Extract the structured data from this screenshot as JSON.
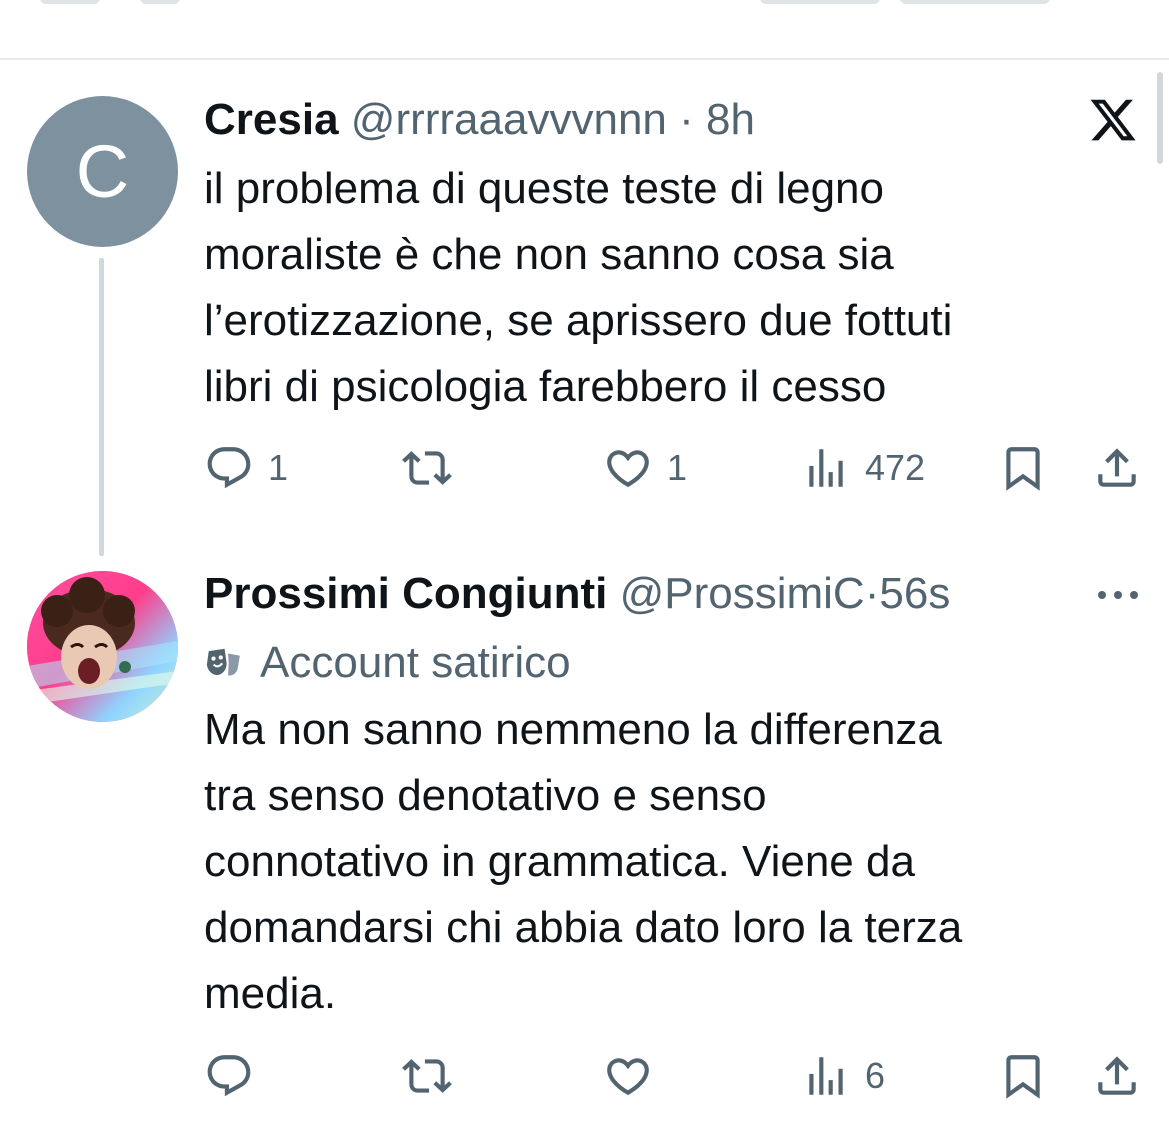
{
  "tweets": [
    {
      "avatar_letter": "C",
      "avatar_color": "#7d919e",
      "name": "Cresia",
      "handle": "@rrrraaavvvnnn",
      "separator": "·",
      "time": "8h",
      "text_lines": [
        "il problema di queste teste di legno",
        "moraliste è che non sanno cosa sia",
        "l’erotizzazione, se aprissero due fottuti",
        "libri di psicologia farebbero il cesso"
      ],
      "counts": {
        "replies": "1",
        "retweets": "",
        "likes": "1",
        "views": "472"
      },
      "corner_icon": "x-logo-icon"
    },
    {
      "avatar_color": "#ff3d8b",
      "name": "Prossimi Congiunti",
      "handle": "@ProssimiC",
      "separator": "·",
      "time": "56s",
      "label_icon": "theater-masks-icon",
      "label": "Account satirico",
      "text_lines": [
        "Ma non sanno nemmeno la differenza",
        "tra senso denotativo e senso",
        "connotativo in grammatica. Viene da",
        "domandarsi chi abbia dato loro la terza",
        "media."
      ],
      "counts": {
        "replies": "",
        "retweets": "",
        "likes": "",
        "views": "6"
      },
      "corner_icon": "more-icon"
    }
  ],
  "colors": {
    "text": "#0f1419",
    "secondary": "#536471",
    "thread_line": "#cfd9de",
    "divider": "#e7e9ea"
  }
}
